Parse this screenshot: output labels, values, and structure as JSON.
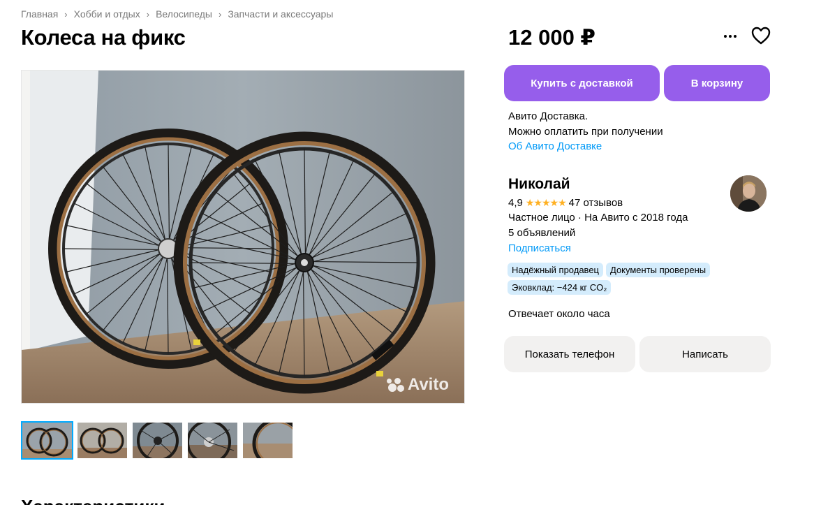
{
  "breadcrumbs": [
    "Главная",
    "Хобби и отдых",
    "Велосипеды",
    "Запчасти и аксессуары"
  ],
  "listing": {
    "title": "Колеса на фикс",
    "price": "12 000 ₽",
    "watermark": "Avito",
    "thumbnail_count": 5,
    "active_thumbnail": 1
  },
  "actions": {
    "more_icon": "more-dots-icon",
    "favorite_icon": "heart-icon",
    "buy_label": "Купить с доставкой",
    "cart_label": "В корзину"
  },
  "delivery": {
    "line1": "Авито Доставка.",
    "line2": "Можно оплатить при получении",
    "link": "Об Авито Доставке"
  },
  "seller": {
    "name": "Николай",
    "rating": "4,9",
    "stars": "★★★★★",
    "reviews": "47 отзывов",
    "type": "Частное лицо · На Авито с 2018 года",
    "listings": "5 объявлений",
    "subscribe": "Подписаться",
    "badges": [
      "Надёжный продавец",
      "Документы проверены",
      "Эковклад: −424 кг CO₂"
    ],
    "response_time": "Отвечает около часа"
  },
  "contact": {
    "phone_label": "Показать телефон",
    "write_label": "Написать"
  },
  "next_section": "Характеристики",
  "colors": {
    "accent": "#965eeb",
    "link": "#0099f7",
    "badge_bg": "#d4ecfc",
    "star": "#ffb021",
    "secondary_btn": "#f2f1f0"
  }
}
